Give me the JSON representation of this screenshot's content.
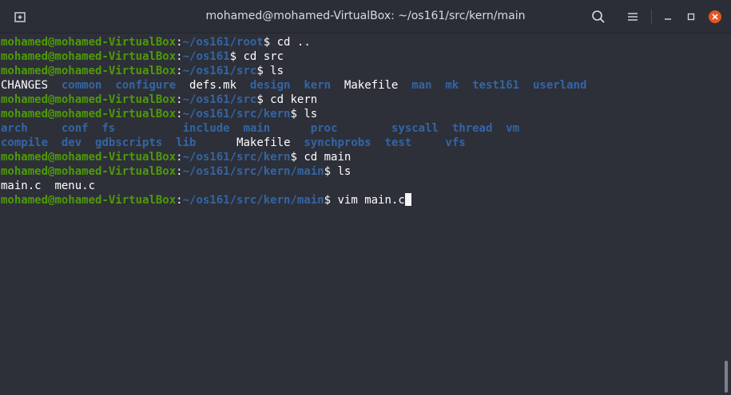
{
  "window": {
    "title": "mohamed@mohamed-VirtualBox: ~/os161/src/kern/main",
    "icons": [
      "new-tab-icon",
      "search-icon",
      "menu-icon",
      "minimize-icon",
      "maximize-icon",
      "close-icon"
    ],
    "colors": {
      "close": "#e95420",
      "background": "#2d3039",
      "prompt_user": "#4e9a06",
      "prompt_path": "#3465a4"
    }
  },
  "prompt": {
    "user": "mohamed@mohamed-VirtualBox",
    "sep": ":",
    "dollar": "$"
  },
  "lines": [
    {
      "type": "prompt",
      "path": "~/os161/root",
      "cmd": " cd .."
    },
    {
      "type": "prompt",
      "path": "~/os161",
      "cmd": " cd src"
    },
    {
      "type": "prompt",
      "path": "~/os161/src",
      "cmd": " ls"
    },
    {
      "type": "listing",
      "items": [
        {
          "text": "CHANGES",
          "kind": "file",
          "pad": 2
        },
        {
          "text": "common",
          "kind": "dir",
          "pad": 2
        },
        {
          "text": "configure",
          "kind": "dir",
          "pad": 2
        },
        {
          "text": "defs.mk",
          "kind": "file",
          "pad": 2
        },
        {
          "text": "design",
          "kind": "dir",
          "pad": 2
        },
        {
          "text": "kern",
          "kind": "dir",
          "pad": 2
        },
        {
          "text": "Makefile",
          "kind": "file",
          "pad": 2
        },
        {
          "text": "man",
          "kind": "dir",
          "pad": 2
        },
        {
          "text": "mk",
          "kind": "dir",
          "pad": 2
        },
        {
          "text": "test161",
          "kind": "dir",
          "pad": 2
        },
        {
          "text": "userland",
          "kind": "dir",
          "pad": 0
        }
      ]
    },
    {
      "type": "prompt",
      "path": "~/os161/src",
      "cmd": " cd kern"
    },
    {
      "type": "prompt",
      "path": "~/os161/src/kern",
      "cmd": " ls"
    },
    {
      "type": "listing",
      "items": [
        {
          "text": "arch",
          "kind": "dir",
          "pad": 5
        },
        {
          "text": "conf",
          "kind": "dir",
          "pad": 2
        },
        {
          "text": "fs",
          "kind": "dir",
          "pad": 10
        },
        {
          "text": "include",
          "kind": "dir",
          "pad": 2
        },
        {
          "text": "main",
          "kind": "dir",
          "pad": 6
        },
        {
          "text": "proc",
          "kind": "dir",
          "pad": 8
        },
        {
          "text": "syscall",
          "kind": "dir",
          "pad": 2
        },
        {
          "text": "thread",
          "kind": "dir",
          "pad": 2
        },
        {
          "text": "vm",
          "kind": "dir",
          "pad": 0
        }
      ]
    },
    {
      "type": "listing",
      "items": [
        {
          "text": "compile",
          "kind": "dir",
          "pad": 2
        },
        {
          "text": "dev",
          "kind": "dir",
          "pad": 2
        },
        {
          "text": "gdbscripts",
          "kind": "dir",
          "pad": 2
        },
        {
          "text": "lib",
          "kind": "dir",
          "pad": 6
        },
        {
          "text": "Makefile",
          "kind": "file",
          "pad": 2
        },
        {
          "text": "synchprobs",
          "kind": "dir",
          "pad": 2
        },
        {
          "text": "test",
          "kind": "dir",
          "pad": 5
        },
        {
          "text": "vfs",
          "kind": "dir",
          "pad": 0
        }
      ]
    },
    {
      "type": "prompt",
      "path": "~/os161/src/kern",
      "cmd": " cd main"
    },
    {
      "type": "prompt",
      "path": "~/os161/src/kern/main",
      "cmd": " ls"
    },
    {
      "type": "listing",
      "items": [
        {
          "text": "main.c",
          "kind": "file",
          "pad": 2
        },
        {
          "text": "menu.c",
          "kind": "file",
          "pad": 0
        }
      ]
    },
    {
      "type": "prompt",
      "path": "~/os161/src/kern/main",
      "cmd": " vim main.c",
      "cursor": true
    }
  ]
}
